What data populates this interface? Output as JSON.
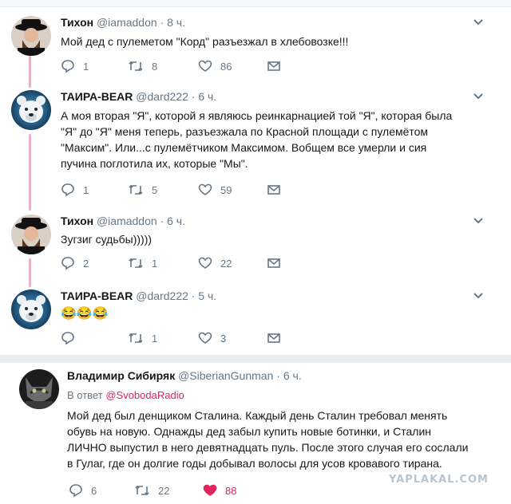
{
  "tweets": [
    {
      "name": "Тихон",
      "handle": "@iamaddon",
      "time": "· 8 ч.",
      "lines": [
        "Мой дед с пулеметом \"Корд\" разъезжал в хлебовозке!!!"
      ],
      "replies": "1",
      "retweets": "8",
      "likes": "86"
    },
    {
      "name": "ТАИРА-BEAR",
      "handle": "@dard222",
      "time": "· 6 ч.",
      "lines": [
        "А моя вторая \"Я\", которой я являюсь реинкарнацией той \"Я\", которая была",
        "\"Я\" до \"Я\" меня теперь, разъезжала по Красной площади с пулемётом",
        "\"Максим\". Или...с пулемётчиком Максимом. Вобщем все умерли и сия",
        "пучина поглотила их, которые \"Мы\"."
      ],
      "replies": "1",
      "retweets": "5",
      "likes": "59"
    },
    {
      "name": "Тихон",
      "handle": "@iamaddon",
      "time": "· 6 ч.",
      "lines": [
        "Зугзиг судьбы)))))"
      ],
      "replies": "2",
      "retweets": "1",
      "likes": "22"
    },
    {
      "name": "ТАИРА-BEAR",
      "handle": "@dard222",
      "time": "· 5 ч.",
      "lines": [
        "😂😂😂"
      ],
      "replies": "",
      "retweets": "1",
      "likes": "3"
    },
    {
      "name": "Владимир Сибиряк",
      "handle": "@SiberianGunman",
      "time": "· 6 ч.",
      "reply_prefix": "В ответ",
      "reply_to": "@SvobodaRadio",
      "lines": [
        "Мой дед был денщиком Сталина. Каждый день Сталин требовал менять",
        "обувь на новую. Однажды дед забыл купить новые ботинки, и Сталин",
        "ЛИЧНО выпустил в него девятнадцать пуль. После этого случая его сослали",
        "в Гулаг, где он долгие годы добывал волосы для усов кровавого тирана."
      ],
      "replies": "6",
      "retweets": "22",
      "likes": "88",
      "liked": true
    }
  ],
  "icons": {
    "reply": "reply-icon",
    "retweet": "retweet-icon",
    "like": "heart-icon",
    "message": "envelope-icon",
    "menu": "chevron-down-icon"
  },
  "colors": {
    "thread_line": "#e8b3c8",
    "like_active": "#e0245e",
    "muted": "#657786"
  },
  "watermark": "YAPLAKAL.COM"
}
